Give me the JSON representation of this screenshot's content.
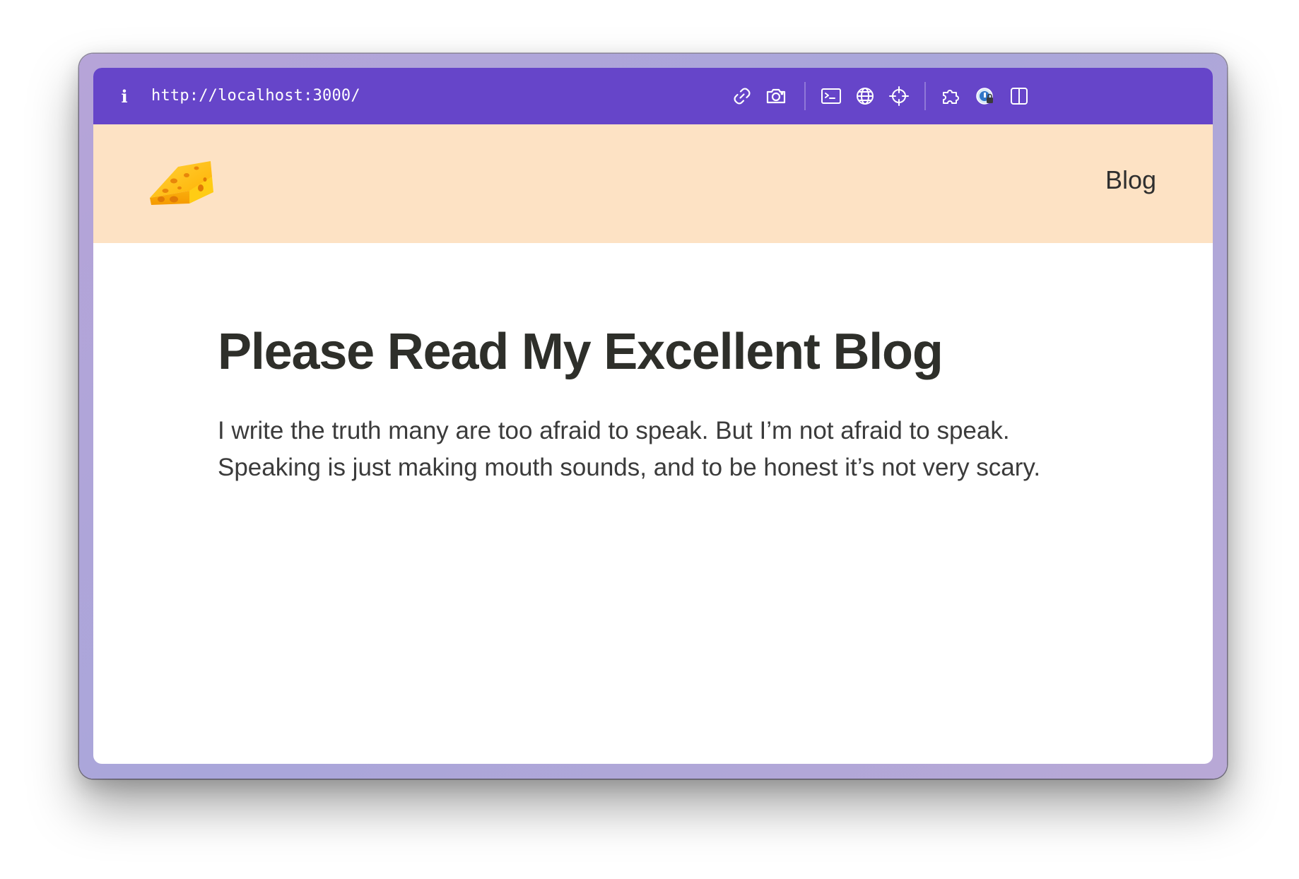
{
  "browser": {
    "url": "http://localhost:3000/",
    "accent_color": "#6645c9",
    "toolbar_icons": [
      "link-icon",
      "camera-icon",
      "terminal-icon",
      "globe-icon",
      "crosshair-icon",
      "extensions-icon",
      "profile-lock-icon",
      "split-view-icon"
    ]
  },
  "site": {
    "header_bg": "#fde2c4",
    "logo": "cheese-icon",
    "nav": {
      "blog": "Blog"
    }
  },
  "main": {
    "title": "Please Read My Excellent Blog",
    "intro_line1": "I write the truth many are too afraid to speak. But I’m not afraid to speak.",
    "intro_line2": "Speaking is just making mouth sounds, and to be honest it’s not very scary."
  }
}
